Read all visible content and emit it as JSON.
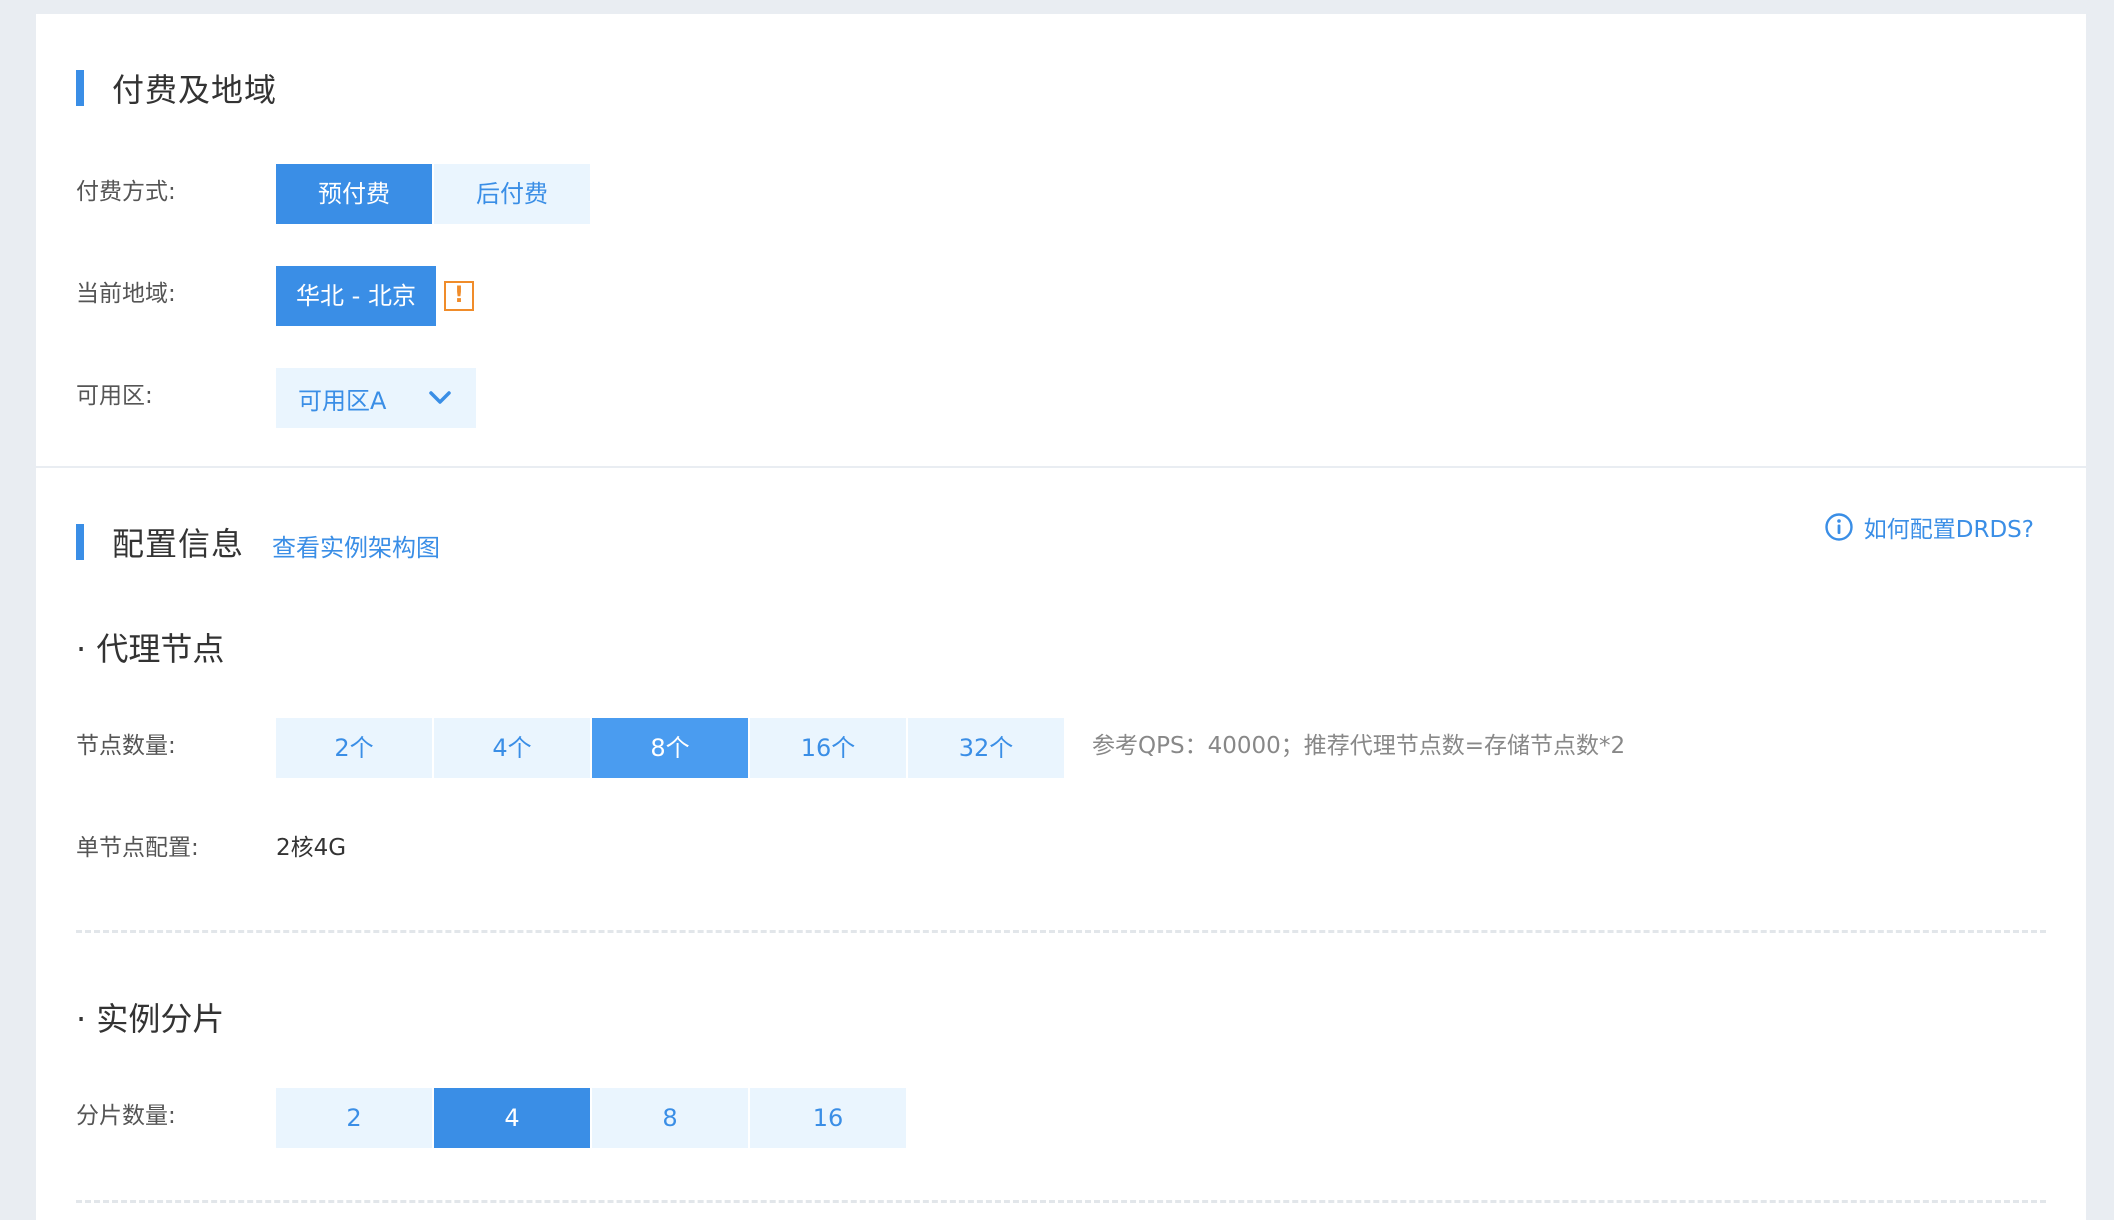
{
  "billing": {
    "title": "付费及地域",
    "payment_label": "付费方式:",
    "payment_options": [
      "预付费",
      "后付费"
    ],
    "payment_selected": "预付费",
    "region_label": "当前地域:",
    "region_value": "华北 - 北京",
    "zone_label": "可用区:",
    "zone_value": "可用区A"
  },
  "config": {
    "title": "配置信息",
    "arch_link": "查看实例架构图",
    "help_link": "如何配置DRDS?",
    "proxy": {
      "title": "· 代理节点",
      "count_label": "节点数量:",
      "count_options": [
        "2个",
        "4个",
        "8个",
        "16个",
        "32个"
      ],
      "count_selected": "8个",
      "hint": "参考QPS：40000；推荐代理节点数=存储节点数*2",
      "spec_label": "单节点配置:",
      "spec_value": "2核4G"
    },
    "shard": {
      "title": "· 实例分片",
      "count_label": "分片数量:",
      "count_options": [
        "2",
        "4",
        "8",
        "16"
      ],
      "count_selected": "4"
    }
  },
  "colors": {
    "accent": "#3a8ee6",
    "option_bg": "#eaf5fe",
    "warning": "#f08c2a"
  },
  "icons": {
    "warning": "warning-icon",
    "info": "info-icon",
    "dropdown": "chevron-down-icon"
  }
}
